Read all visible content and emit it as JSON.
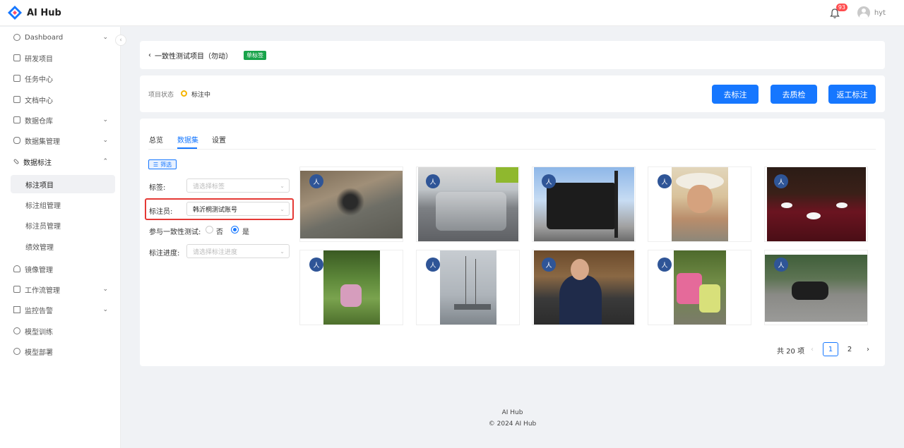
{
  "app": {
    "title": "AI Hub",
    "notifications": "93",
    "user": "hyt"
  },
  "sidebar": {
    "items": [
      {
        "label": "Dashboard",
        "icon": "dashboard-icon",
        "has_chevron": true
      },
      {
        "label": "研发项目",
        "icon": "folder-icon"
      },
      {
        "label": "任务中心",
        "icon": "task-icon"
      },
      {
        "label": "文档中心",
        "icon": "doc-icon"
      },
      {
        "label": "数据仓库",
        "icon": "home-icon",
        "has_chevron": true
      },
      {
        "label": "数据集管理",
        "icon": "database-icon",
        "has_chevron": true
      },
      {
        "label": "数据标注",
        "icon": "pen-icon",
        "expanded": true
      },
      {
        "label": "镜像管理",
        "icon": "image-icon"
      },
      {
        "label": "工作流管理",
        "icon": "workflow-icon",
        "has_chevron": true
      },
      {
        "label": "监控告警",
        "icon": "alert-icon",
        "has_chevron": true
      },
      {
        "label": "模型训练",
        "icon": "train-icon"
      },
      {
        "label": "模型部署",
        "icon": "deploy-icon"
      }
    ],
    "subitems": [
      {
        "label": "标注项目",
        "active": true
      },
      {
        "label": "标注组管理"
      },
      {
        "label": "标注员管理"
      },
      {
        "label": "绩效管理"
      }
    ]
  },
  "project": {
    "back_label": "一致性测试项目（勿动）",
    "tag": "单标签",
    "status_label": "项目状态",
    "status_value": "标注中"
  },
  "actions": {
    "annotate": "去标注",
    "qa": "去质检",
    "rework": "返工标注"
  },
  "tabs": {
    "overview": "总览",
    "dataset": "数据集",
    "settings": "设置"
  },
  "filters": {
    "button": "筛选",
    "tag_label": "标签:",
    "tag_placeholder": "请选择标签",
    "annotator_label": "标注员:",
    "annotator_value": "韩沂桐测试账号",
    "consistency_label": "参与一致性测试:",
    "no": "否",
    "yes": "是",
    "progress_label": "标注进度:",
    "progress_placeholder": "请选择标注进度"
  },
  "thumb_badge": "人",
  "pagination": {
    "total": "共 20 项",
    "page1": "1",
    "page2": "2"
  },
  "footer": {
    "line1": "AI Hub",
    "line2": "© 2024 AI Hub"
  },
  "colors": {
    "primary": "#1677ff",
    "tag_green": "#18a34a",
    "highlight": "#e53935"
  }
}
